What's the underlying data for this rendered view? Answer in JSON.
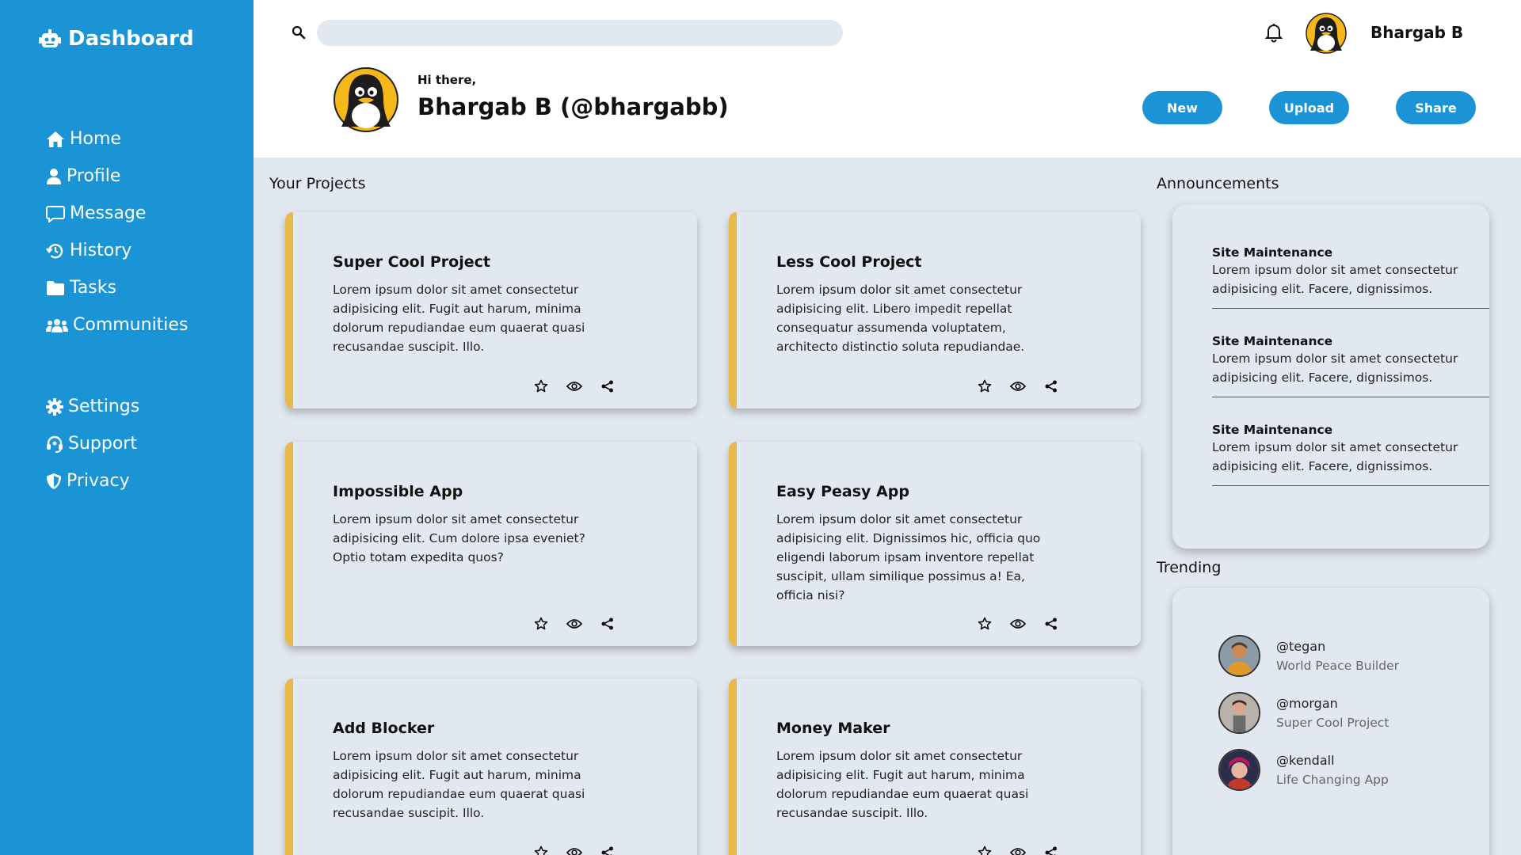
{
  "sidebar": {
    "brand": "Dashboard",
    "main_nav": [
      {
        "label": "Home",
        "icon": "home-icon"
      },
      {
        "label": "Profile",
        "icon": "user-icon"
      },
      {
        "label": "Message",
        "icon": "message-icon"
      },
      {
        "label": "History",
        "icon": "history-icon"
      },
      {
        "label": "Tasks",
        "icon": "folder-icon"
      },
      {
        "label": "Communities",
        "icon": "users-icon"
      }
    ],
    "secondary_nav": [
      {
        "label": "Settings",
        "icon": "gear-icon"
      },
      {
        "label": "Support",
        "icon": "headset-icon"
      },
      {
        "label": "Privacy",
        "icon": "shield-icon"
      }
    ]
  },
  "header": {
    "search": {
      "value": "",
      "placeholder": ""
    },
    "user_name": "Bhargab B",
    "greeting": "Hi there,",
    "hero_name": "Bhargab B (@bhargabb)",
    "buttons": {
      "new": "New",
      "upload": "Upload",
      "share": "Share"
    }
  },
  "projects": {
    "title": "Your Projects",
    "items": [
      {
        "title": "Super Cool Project",
        "description": "Lorem ipsum dolor sit amet consectetur adipisicing elit. Fugit aut harum, minima dolorum repudiandae eum quaerat quasi recusandae suscipit. Illo."
      },
      {
        "title": "Less Cool Project",
        "description": "Lorem ipsum dolor sit amet consectetur adipisicing elit. Libero impedit repellat consequatur assumenda voluptatem, architecto distinctio soluta repudiandae."
      },
      {
        "title": "Impossible App",
        "description": "Lorem ipsum dolor sit amet consectetur adipisicing elit. Cum dolore ipsa eveniet? Optio totam expedita quos?"
      },
      {
        "title": "Easy Peasy App",
        "description": "Lorem ipsum dolor sit amet consectetur adipisicing elit. Dignissimos hic, officia quo eligendi laborum ipsam inventore repellat suscipit, ullam similique possimus a! Ea, officia nisi?"
      },
      {
        "title": "Add Blocker",
        "description": "Lorem ipsum dolor sit amet consectetur adipisicing elit. Fugit aut harum, minima dolorum repudiandae eum quaerat quasi recusandae suscipit. Illo."
      },
      {
        "title": "Money Maker",
        "description": "Lorem ipsum dolor sit amet consectetur adipisicing elit. Fugit aut harum, minima dolorum repudiandae eum quaerat quasi recusandae suscipit. Illo."
      }
    ]
  },
  "announcements": {
    "title": "Announcements",
    "items": [
      {
        "title": "Site Maintenance",
        "body": "Lorem ipsum dolor sit amet consectetur adipisicing elit. Facere, dignissimos."
      },
      {
        "title": "Site Maintenance",
        "body": "Lorem ipsum dolor sit amet consectetur adipisicing elit. Facere, dignissimos."
      },
      {
        "title": "Site Maintenance",
        "body": "Lorem ipsum dolor sit amet consectetur adipisicing elit. Facere, dignissimos."
      }
    ]
  },
  "trending": {
    "title": "Trending",
    "items": [
      {
        "handle": "@tegan",
        "project": "World Peace Builder"
      },
      {
        "handle": "@morgan",
        "project": "Super Cool Project"
      },
      {
        "handle": "@kendall",
        "project": "Life Changing App"
      }
    ]
  },
  "colors": {
    "accent": "#1a94d4",
    "card_stripe": "#e9b949",
    "background": "#e2e8f0"
  }
}
